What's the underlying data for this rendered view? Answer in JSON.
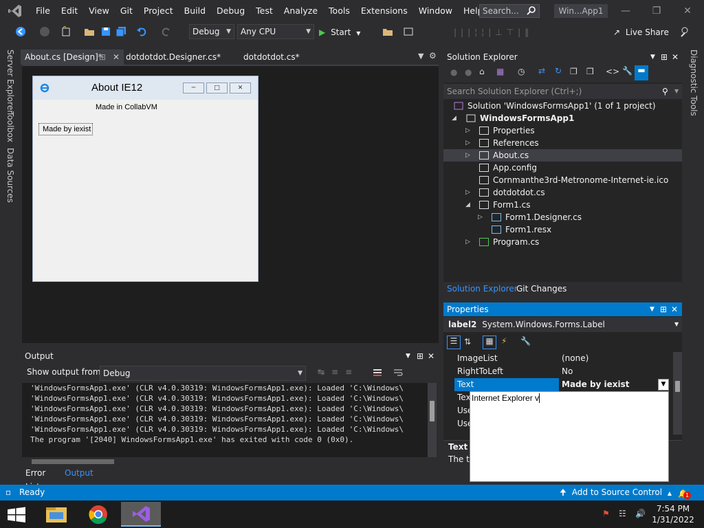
{
  "menu": {
    "items": [
      "File",
      "Edit",
      "View",
      "Git",
      "Project",
      "Build",
      "Debug",
      "Test",
      "Analyze",
      "Tools",
      "Extensions",
      "Window",
      "Help"
    ],
    "search_placeholder": "Search...",
    "solution_title": "Win...App1"
  },
  "toolbar": {
    "config": "Debug",
    "platform": "Any CPU",
    "start_label": "Start",
    "live_share": "Live Share"
  },
  "left_tabs": [
    "Server Explorer",
    "Toolbox",
    "Data Sources"
  ],
  "right_tabs": [
    "Diagnostic Tools"
  ],
  "doc_tabs": [
    {
      "label": "About.cs [Design]*",
      "active": true
    },
    {
      "label": "dotdotdot.Designer.cs*",
      "active": false
    },
    {
      "label": "dotdotdot.cs*",
      "active": false
    }
  ],
  "form": {
    "title": "About IE12",
    "label1": "Made in CollabVM",
    "label2": "Made by iexist"
  },
  "output": {
    "title": "Output",
    "show_from_label": "Show output from:",
    "source": "Debug",
    "lines": [
      "'WindowsFormsApp1.exe' (CLR v4.0.30319: WindowsFormsApp1.exe): Loaded 'C:\\Windows\\",
      "'WindowsFormsApp1.exe' (CLR v4.0.30319: WindowsFormsApp1.exe): Loaded 'C:\\Windows\\",
      "'WindowsFormsApp1.exe' (CLR v4.0.30319: WindowsFormsApp1.exe): Loaded 'C:\\Windows\\",
      "'WindowsFormsApp1.exe' (CLR v4.0.30319: WindowsFormsApp1.exe): Loaded 'C:\\Windows\\",
      "'WindowsFormsApp1.exe' (CLR v4.0.30319: WindowsFormsApp1.exe): Loaded 'C:\\Windows\\",
      "The program '[2040] WindowsFormsApp1.exe' has exited with code 0 (0x0)."
    ]
  },
  "bottom_tabs": [
    "Error List",
    "Output"
  ],
  "solution_explorer": {
    "title": "Solution Explorer",
    "search_placeholder": "Search Solution Explorer (Ctrl+;)",
    "solution": "Solution 'WindowsFormsApp1' (1 of 1 project)",
    "project": "WindowsFormsApp1",
    "items": [
      {
        "label": "Properties",
        "icon": "wrench-icon"
      },
      {
        "label": "References",
        "icon": "references-icon"
      },
      {
        "label": "About.cs",
        "icon": "form-icon"
      },
      {
        "label": "App.config",
        "icon": "config-icon"
      },
      {
        "label": "Cornmanthe3rd-Metronome-Internet-ie.ico",
        "icon": "file-icon"
      },
      {
        "label": "dotdotdot.cs",
        "icon": "form-icon"
      },
      {
        "label": "Form1.cs",
        "icon": "form-icon"
      },
      {
        "label": "Form1.Designer.cs",
        "icon": "designer-icon"
      },
      {
        "label": "Form1.resx",
        "icon": "resx-icon"
      },
      {
        "label": "Program.cs",
        "icon": "csharp-icon"
      }
    ],
    "tabs": [
      "Solution Explorer",
      "Git Changes"
    ]
  },
  "properties": {
    "title": "Properties",
    "object_name": "label2",
    "object_type": "System.Windows.Forms.Label",
    "rows": [
      {
        "name": "ImageList",
        "value": "(none)"
      },
      {
        "name": "RightToLeft",
        "value": "No"
      },
      {
        "name": "Text",
        "value": "Made by iexist"
      },
      {
        "name": "Tex",
        "value": ""
      },
      {
        "name": "Use",
        "value": ""
      },
      {
        "name": "Use",
        "value": ""
      }
    ],
    "dropdown_text": "Internet Explorer v",
    "desc_title": "Text",
    "desc_text": "The te"
  },
  "status": {
    "ready": "Ready",
    "source_control": "Add to Source Control",
    "notifications": "1"
  },
  "taskbar": {
    "time": "7:54 PM",
    "date": "1/31/2022"
  },
  "colors": {
    "accent": "#007acc",
    "background": "#2d2d30",
    "editor": "#1e1e1e",
    "tool_window": "#252526"
  }
}
